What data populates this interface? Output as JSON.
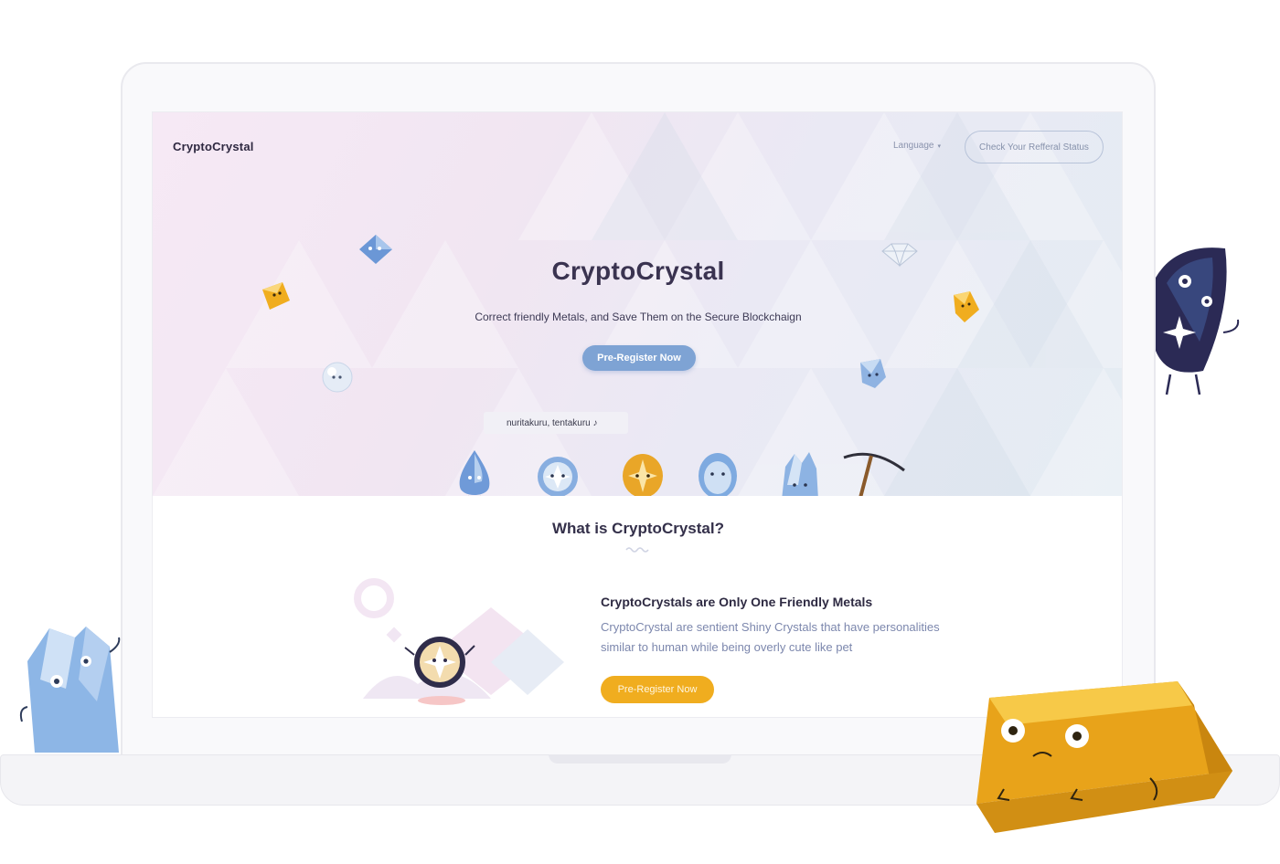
{
  "nav": {
    "brand": "CryptoCrystal",
    "language_label": "Language",
    "language_caret": "▾",
    "referral_label": "Check Your Refferal Status"
  },
  "hero": {
    "title": "CryptoCrystal",
    "subtitle": "Correct friendly Metals, and Save Them on the Secure Blockchaign",
    "cta_label": "Pre-Register Now",
    "speech_text": "nuritakuru, tentakuru ♪"
  },
  "about": {
    "section_title": "What is CryptoCrystal?",
    "feature_title": "CryptoCrystals are Only One Friendly Metals",
    "feature_desc": "CryptoCrystal are sentient Shiny Crystals that have personalities similar to human while being overly cute like pet",
    "cta_label": "Pre-Register Now"
  },
  "colors": {
    "accent_blue": "#7ea3d4",
    "accent_gold": "#f0ad1f",
    "text_dark": "#34304a",
    "text_muted": "#7c87ad"
  },
  "icons": [
    "crystal-character",
    "gold-bar-character",
    "pickaxe-icon",
    "diamond-icon",
    "caret-down-icon"
  ]
}
